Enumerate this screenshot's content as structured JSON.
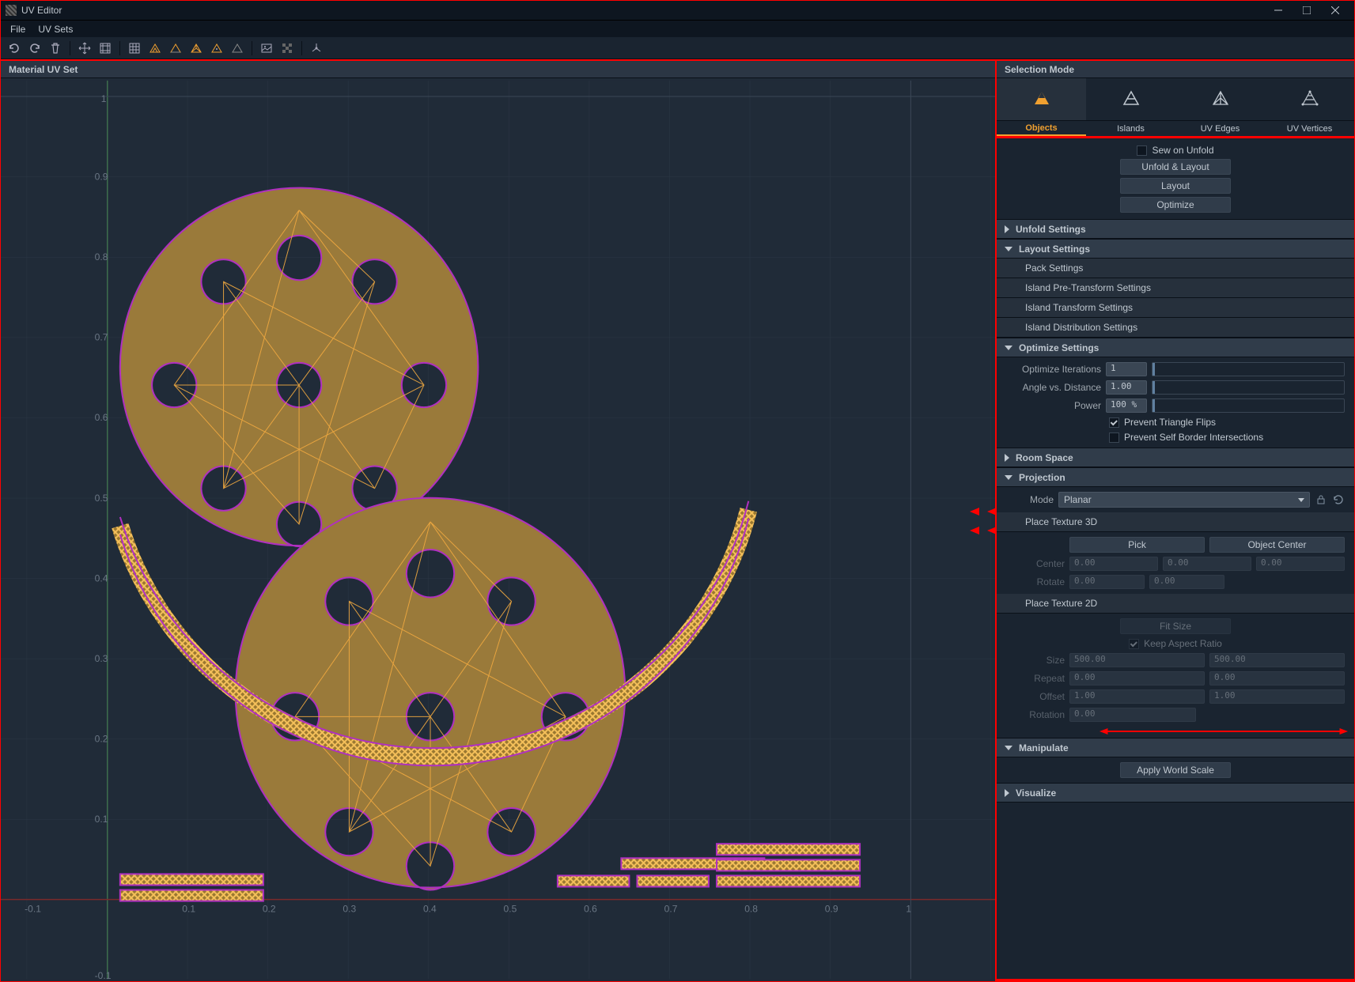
{
  "window": {
    "title": "UV Editor"
  },
  "menubar": {
    "file": "File",
    "uvsets": "UV Sets"
  },
  "viewport": {
    "header": "Material UV Set",
    "ticks": [
      "-0.1",
      "0.1",
      "0.2",
      "0.3",
      "0.4",
      "0.5",
      "0.6",
      "0.7",
      "0.8",
      "0.9",
      "1"
    ]
  },
  "side": {
    "header": "Selection Mode",
    "tabs": {
      "objects": "Objects",
      "islands": "Islands",
      "uvedges": "UV Edges",
      "uvverts": "UV Vertices"
    },
    "actions": {
      "sew_label": "Sew on Unfold",
      "unfold_layout": "Unfold & Layout",
      "layout": "Layout",
      "optimize": "Optimize"
    },
    "unfold_settings": "Unfold Settings",
    "layout_settings": "Layout Settings",
    "pack_settings": "Pack Settings",
    "island_pre": "Island Pre-Transform Settings",
    "island_trans": "Island Transform Settings",
    "island_dist": "Island Distribution Settings",
    "optimize_settings": "Optimize Settings",
    "opt": {
      "iter_label": "Optimize Iterations",
      "iter_val": "1",
      "angle_label": "Angle vs. Distance",
      "angle_val": "1.00",
      "power_label": "Power",
      "power_val": "100 %",
      "flips": "Prevent Triangle Flips",
      "borders": "Prevent Self Border Intersections"
    },
    "room_space": "Room Space",
    "projection": "Projection",
    "proj": {
      "mode_label": "Mode",
      "mode_val": "Planar"
    },
    "place3d": "Place Texture 3D",
    "p3d": {
      "pick": "Pick",
      "obj_center": "Object Center",
      "center_label": "Center",
      "cx": "0.00",
      "cy": "0.00",
      "cz": "0.00",
      "rotate_label": "Rotate",
      "rx": "0.00",
      "ry": "0.00"
    },
    "place2d": "Place Texture 2D",
    "p2d": {
      "fit": "Fit Size",
      "keep": "Keep Aspect Ratio",
      "size_label": "Size",
      "sx": "500.00",
      "sy": "500.00",
      "repeat_label": "Repeat",
      "rpx": "0.00",
      "rpy": "0.00",
      "offset_label": "Offset",
      "ox": "1.00",
      "oy": "1.00",
      "rot_label": "Rotation",
      "rot": "0.00"
    },
    "manipulate": "Manipulate",
    "apply_world": "Apply World Scale",
    "visualize": "Visualize"
  }
}
